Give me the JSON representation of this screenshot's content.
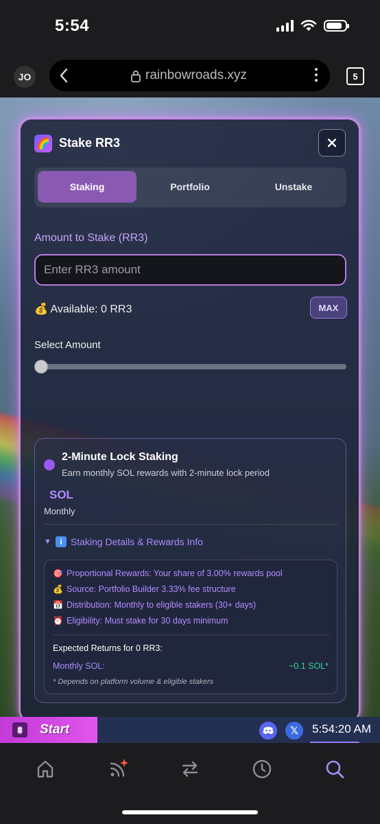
{
  "status_bar": {
    "time": "5:54"
  },
  "browser": {
    "profile_initials": "JO",
    "url": "rainbowroads.xyz",
    "tab_count": "5"
  },
  "modal": {
    "title": "Stake RR3",
    "title_icon": "rainbow-icon",
    "tabs": [
      {
        "label": "Staking",
        "active": true
      },
      {
        "label": "Portfolio",
        "active": false
      },
      {
        "label": "Unstake",
        "active": false
      }
    ],
    "amount_label": "Amount to Stake (RR3)",
    "amount_placeholder": "Enter RR3 amount",
    "amount_value": "",
    "available_icon": "💰",
    "available_text": "Available: 0 RR3",
    "max_label": "MAX",
    "select_label": "Select Amount",
    "slider_value": 0,
    "plan": {
      "title": "2-Minute Lock Staking",
      "subtitle": "Earn monthly SOL rewards with 2-minute lock period",
      "reward_token": "SOL",
      "reward_frequency": "Monthly",
      "details_toggle": "Staking Details & Rewards Info",
      "details": [
        {
          "icon": "🎯",
          "text": "Proportional Rewards: Your share of 3.00% rewards pool"
        },
        {
          "icon": "💰",
          "text": "Source: Portfolio Builder 3.33% fee structure"
        },
        {
          "icon": "📅",
          "text": "Distribution: Monthly to eligible stakers (30+ days)"
        },
        {
          "icon": "⏰",
          "text": "Eligibility: Must stake for 30 days minimum"
        }
      ],
      "returns_title": "Expected Returns for 0 RR3:",
      "monthly_label": "Monthly SOL:",
      "monthly_value": "~0.1 SOL*",
      "footnote": "* Depends on platform volume & eligible stakers"
    }
  },
  "taskbar": {
    "start_label": "Start",
    "clock": "5:54:20 AM"
  },
  "bottom_nav": {
    "items": [
      "home-icon",
      "feed-icon",
      "swap-icon",
      "history-icon",
      "search-icon"
    ],
    "active": "search-icon"
  },
  "colors": {
    "accent_purple": "#8a5ab3",
    "input_border": "#b97be0",
    "positive_green": "#34d399",
    "modal_glow": "#e296ff",
    "start_magenta": "#d048e4"
  }
}
